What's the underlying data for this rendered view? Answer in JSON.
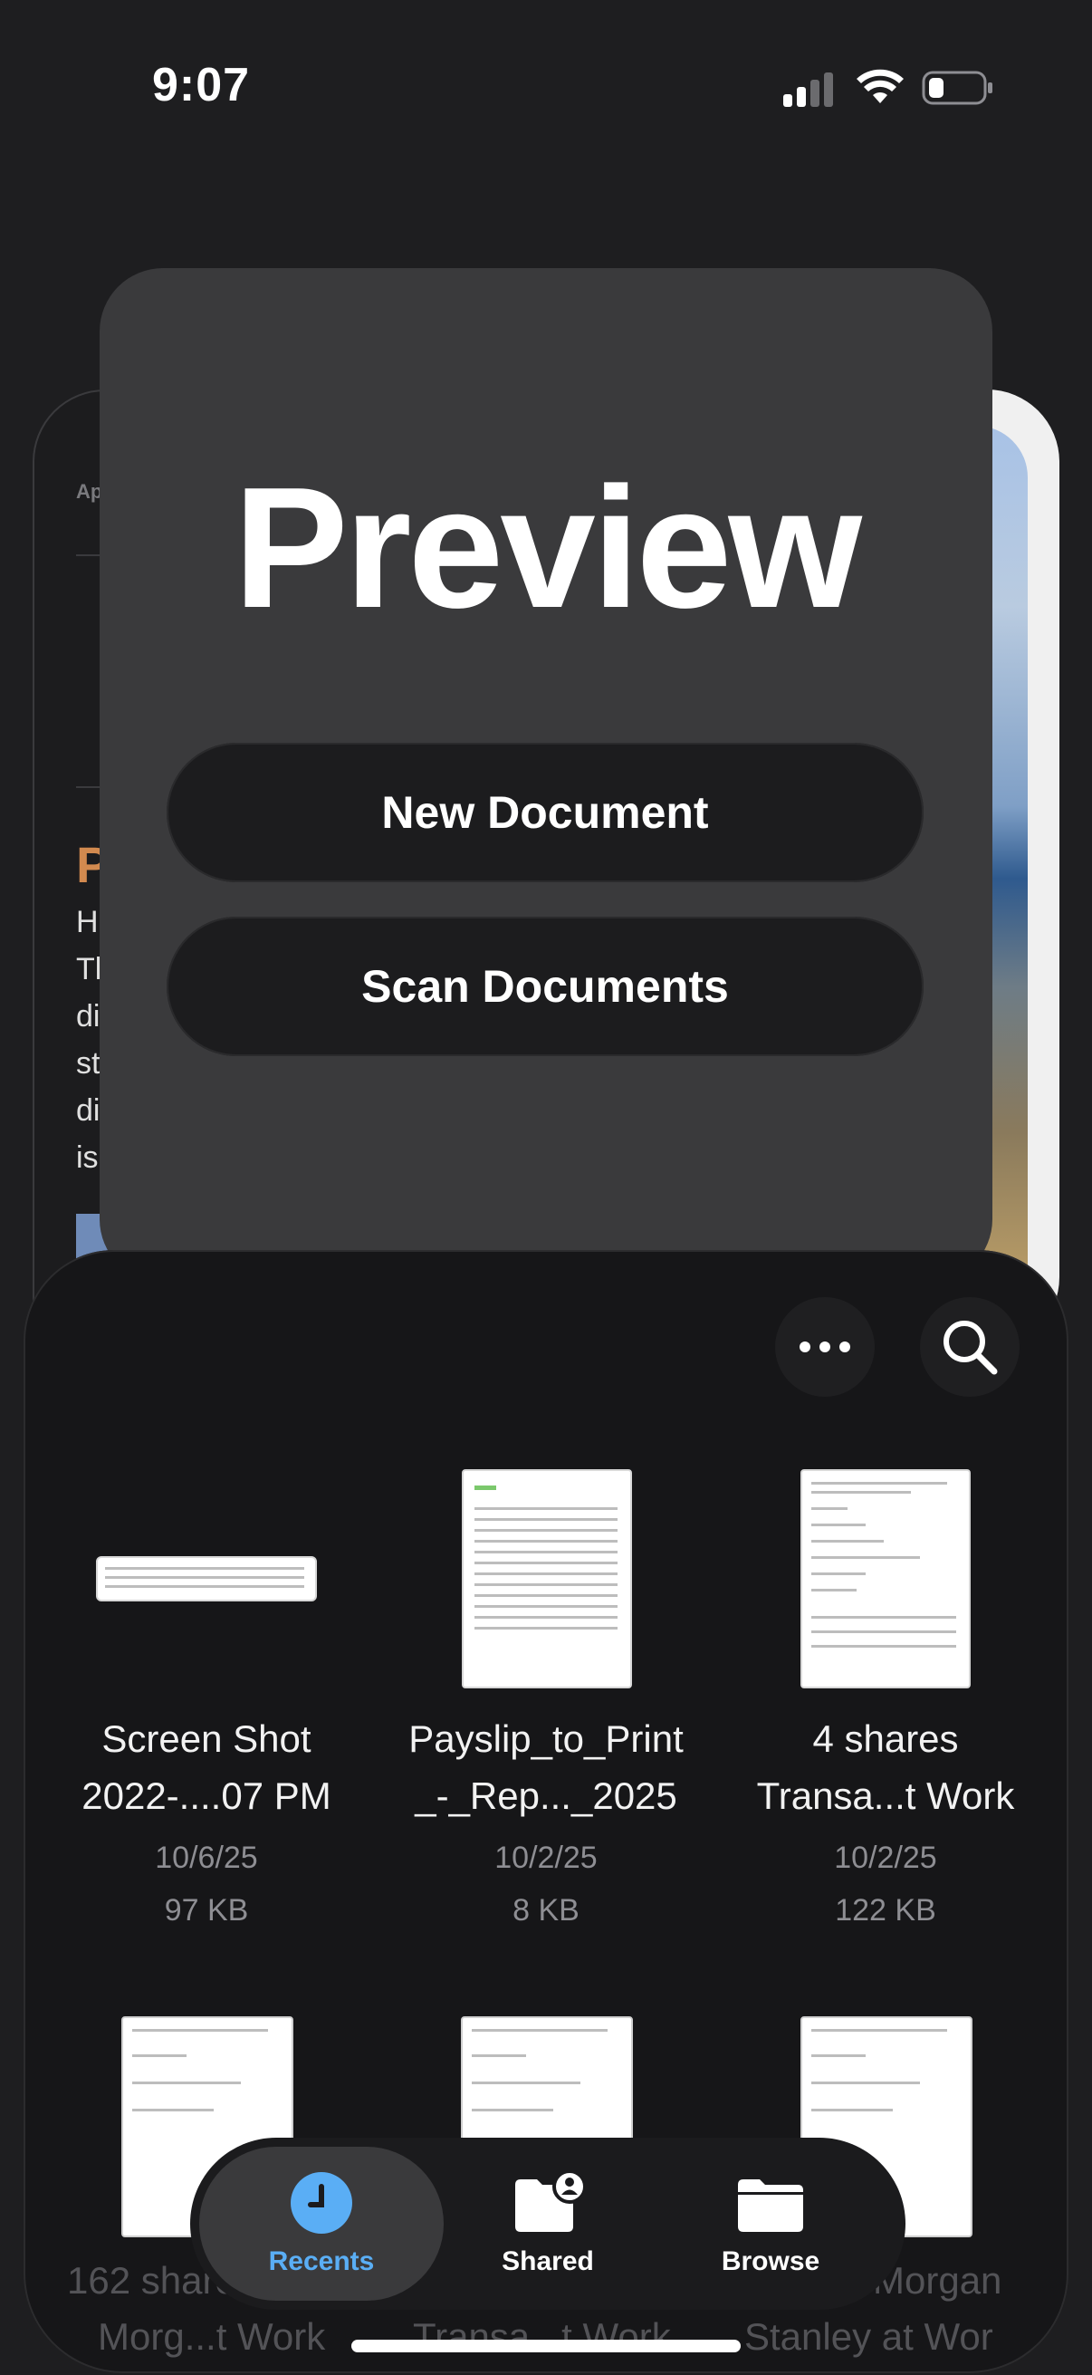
{
  "status_bar": {
    "time": "9:07"
  },
  "bg_left": {
    "header": "Ap",
    "letter": "P",
    "lines": [
      "H",
      "Tl",
      "di",
      "st",
      "di",
      "is"
    ]
  },
  "preview": {
    "title": "Preview",
    "new_document": "New Document",
    "scan_documents": "Scan Documents"
  },
  "toolbar": {
    "more_icon": "ellipsis-icon",
    "search_icon": "search-icon"
  },
  "files": [
    {
      "name_line1": "Screen Shot",
      "name_line2": "2022-....07 PM",
      "date": "10/6/25",
      "size": "97 KB"
    },
    {
      "name_line1": "Payslip_to_Print",
      "name_line2": "_-_Rep..._2025",
      "date": "10/2/25",
      "size": "8 KB"
    },
    {
      "name_line1": "4 shares",
      "name_line2": "Transa...t Work",
      "date": "10/2/25",
      "size": "122 KB"
    }
  ],
  "second_row_labels": {
    "left_line1": "162 share",
    "left_line2": "Morg...t Work",
    "mid_line2": "Transa...t Work",
    "right_line1": "Morgan",
    "right_line2": "Stanley at Wor"
  },
  "tabs": [
    {
      "label": "Recents",
      "icon": "clock-icon",
      "active": true
    },
    {
      "label": "Shared",
      "icon": "shared-folder-icon",
      "active": false
    },
    {
      "label": "Browse",
      "icon": "folder-icon",
      "active": false
    }
  ],
  "colors": {
    "accent": "#5aaef5",
    "background": "#1e1e20",
    "card": "#3a3a3c"
  }
}
